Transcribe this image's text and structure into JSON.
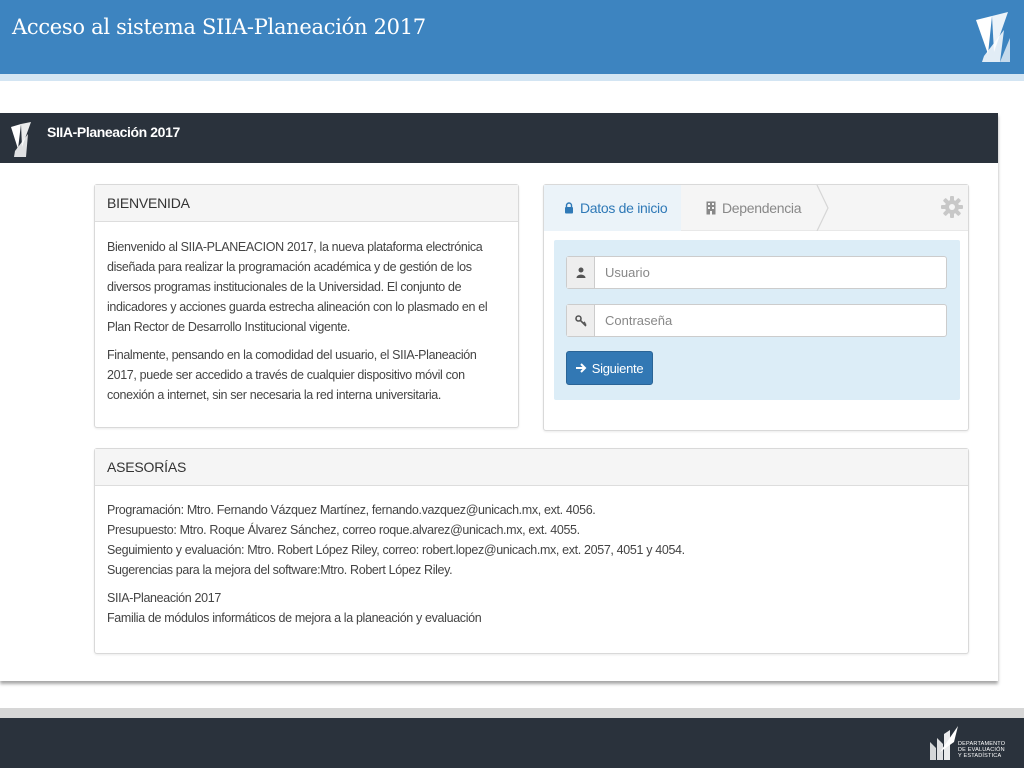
{
  "slide": {
    "title": "Acceso al sistema SIIA-Planeación 2017"
  },
  "navbar": {
    "brand": "SIIA-Planeación 2017"
  },
  "welcome": {
    "heading": "BIENVENIDA",
    "paragraph1": "Bienvenido al SIIA-PLANEACION 2017, la nueva plataforma electrónica diseñada para realizar la programación académica y de gestión de los diversos programas institucionales de la Universidad. El conjunto de indicadores y acciones guarda estrecha alineación con lo plasmado en el Plan Rector de Desarrollo Institucional vigente.",
    "paragraph2": "Finalmente, pensando en la comodidad del usuario, el SIIA-Planeación 2017, puede ser accedido a través de cualquier dispositivo móvil con conexión a internet, sin ser necesaria la red interna universitaria."
  },
  "login": {
    "tabs": [
      {
        "label": "Datos de inicio",
        "icon": "lock-icon",
        "active": true
      },
      {
        "label": "Dependencia",
        "icon": "building-icon",
        "active": false
      }
    ],
    "settings_icon": "gear-icon",
    "username_placeholder": "Usuario",
    "password_placeholder": "Contraseña",
    "next_button_label": "Siguiente"
  },
  "advice": {
    "heading": "ASESORÍAS",
    "lines": [
      "Programación: Mtro. Fernando Vázquez Martínez, fernando.vazquez@unicach.mx, ext. 4056.",
      "Presupuesto: Mtro. Roque Álvarez Sánchez, correo roque.alvarez@unicach.mx, ext. 4055.",
      "Seguimiento y evaluación: Mtro. Robert López Riley, correo: robert.lopez@unicach.mx, ext. 2057, 4051 y 4054.",
      "Sugerencias para la mejora del software:Mtro. Robert López Riley."
    ],
    "footer_title": "SIIA-Planeación 2017",
    "footer_subtitle": "Familia de módulos informáticos de mejora a la planeación y evaluación"
  },
  "footer": {
    "dept_line1": "DEPARTAMENTO",
    "dept_line2": "DE EVALUACIÓN",
    "dept_line3": "Y ESTADÍSTICA"
  },
  "colors": {
    "header_blue": "#3d84c0",
    "navbar_dark": "#2a323c",
    "primary_button": "#3278b4",
    "login_box": "#dcedf7"
  }
}
